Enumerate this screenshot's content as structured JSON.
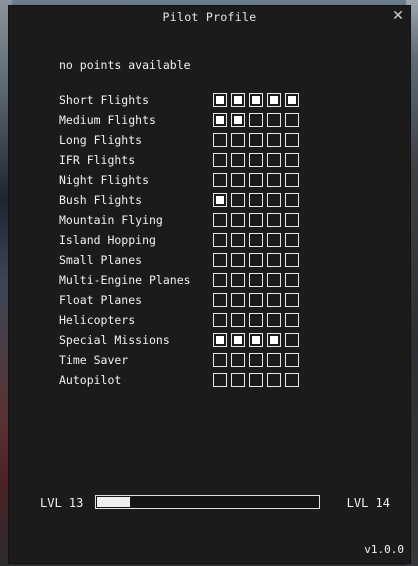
{
  "window": {
    "title": "Pilot Profile",
    "close_glyph": "✕",
    "close_icon": "close-icon"
  },
  "points_text": "no points available",
  "skills": [
    {
      "label": "Short Flights",
      "filled": 5,
      "total": 5
    },
    {
      "label": "Medium Flights",
      "filled": 2,
      "total": 5
    },
    {
      "label": "Long Flights",
      "filled": 0,
      "total": 5
    },
    {
      "label": "IFR Flights",
      "filled": 0,
      "total": 5
    },
    {
      "label": "Night Flights",
      "filled": 0,
      "total": 5
    },
    {
      "label": "Bush Flights",
      "filled": 1,
      "total": 5
    },
    {
      "label": "Mountain Flying",
      "filled": 0,
      "total": 5
    },
    {
      "label": "Island Hopping",
      "filled": 0,
      "total": 5
    },
    {
      "label": "Small Planes",
      "filled": 0,
      "total": 5
    },
    {
      "label": "Multi-Engine Planes",
      "filled": 0,
      "total": 5
    },
    {
      "label": "Float Planes",
      "filled": 0,
      "total": 5
    },
    {
      "label": "Helicopters",
      "filled": 0,
      "total": 5
    },
    {
      "label": "Special Missions",
      "filled": 4,
      "total": 5
    },
    {
      "label": "Time Saver",
      "filled": 0,
      "total": 5
    },
    {
      "label": "Autopilot",
      "filled": 0,
      "total": 5
    }
  ],
  "level": {
    "current": "LVL 13",
    "next": "LVL 14",
    "progress": 0.15
  },
  "version": "v1.0.0"
}
